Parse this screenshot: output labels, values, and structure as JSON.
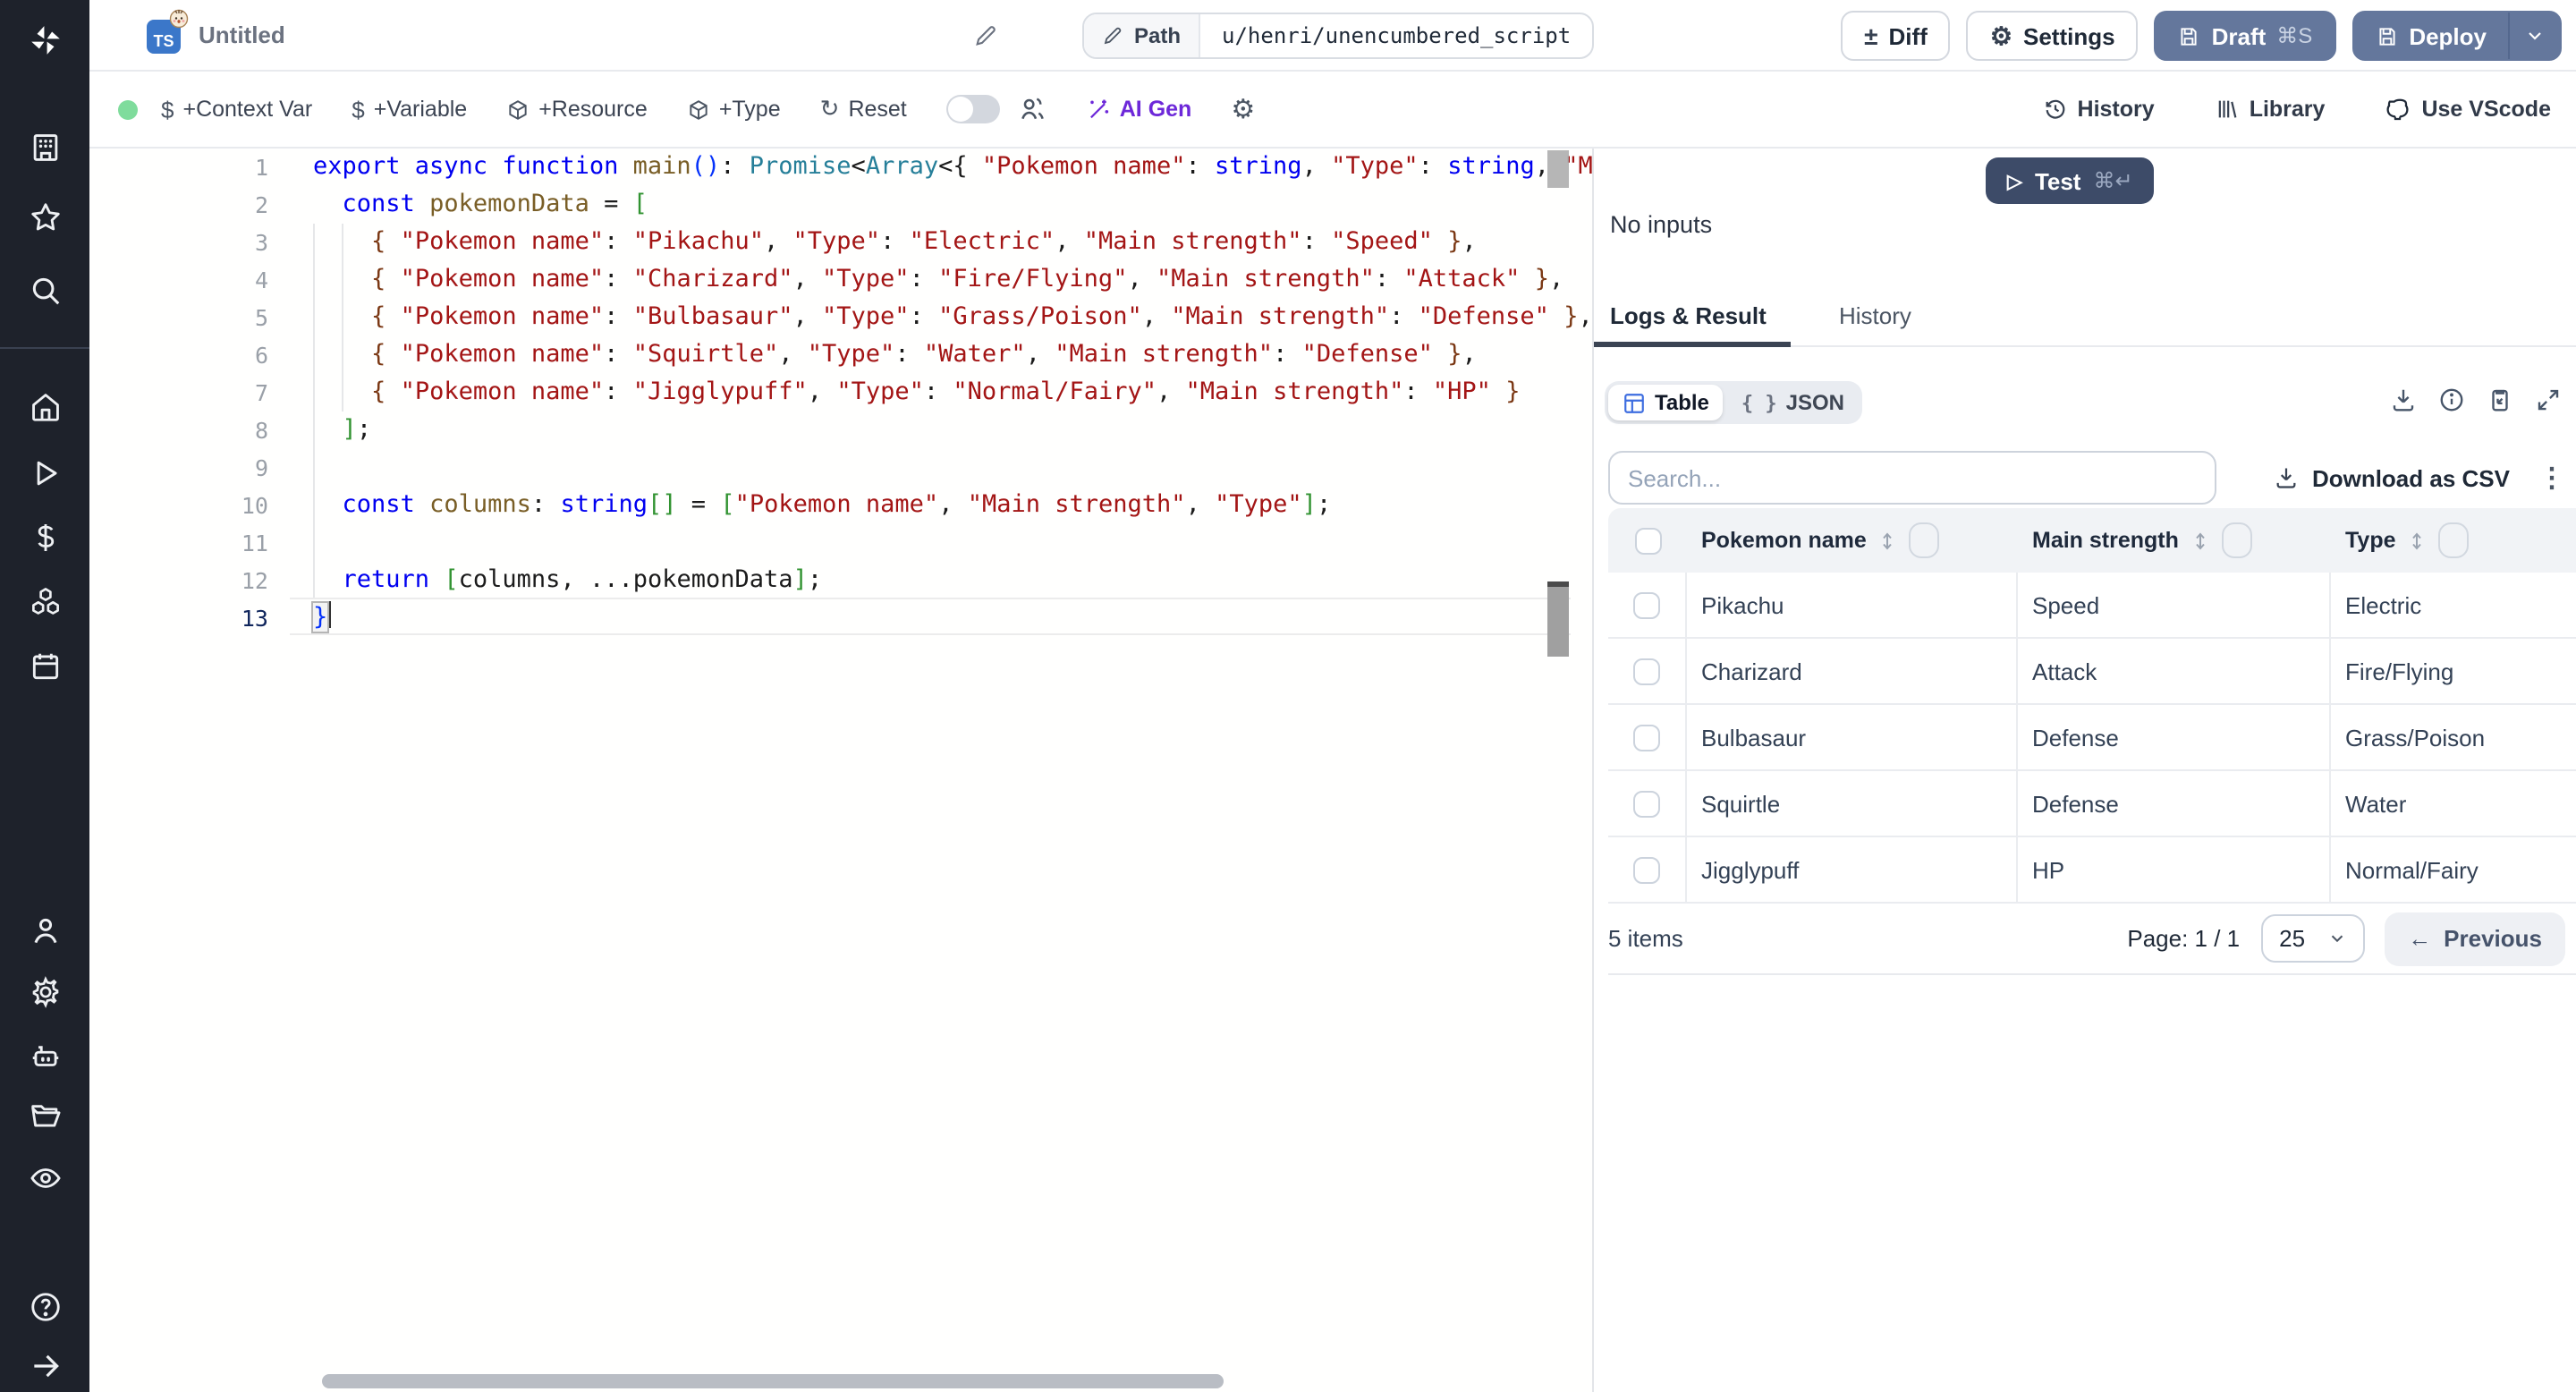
{
  "topbar": {
    "ts_label": "TS",
    "badge_emoji": "bun-face",
    "title": "Untitled",
    "path_label": "Path",
    "path_value": "u/henri/unencumbered_script",
    "diff": "Diff",
    "settings": "Settings",
    "draft": "Draft",
    "draft_kbd": "⌘S",
    "deploy": "Deploy"
  },
  "toolbar": {
    "context_var": "+Context Var",
    "variable": "+Variable",
    "resource": "+Resource",
    "type": "+Type",
    "reset": "Reset",
    "ai_gen": "AI Gen",
    "history": "History",
    "library": "Library",
    "use_vscode": "Use VScode"
  },
  "sidebar": {
    "items": [
      "windmill-logo",
      "workspace",
      "favorites",
      "search",
      "home",
      "runs",
      "variables",
      "resources",
      "schedules",
      "user",
      "settings",
      "workers",
      "folders",
      "audit-logs",
      "help",
      "expand-sidebar"
    ]
  },
  "editor": {
    "lines": [
      {
        "n": "1",
        "g": 0,
        "tokens": [
          [
            "export async function ",
            "kw"
          ],
          [
            "main",
            "fn"
          ],
          [
            "()",
            "br1"
          ],
          [
            ": ",
            "pun"
          ],
          [
            "Promise",
            "type"
          ],
          [
            "<",
            "pun"
          ],
          [
            "Array",
            "type"
          ],
          [
            "<{ ",
            "pun"
          ],
          [
            "\"Pokemon name\"",
            "str"
          ],
          [
            ": ",
            "pun"
          ],
          [
            "string",
            "kw"
          ],
          [
            ", ",
            "pun"
          ],
          [
            "\"Type\"",
            "str"
          ],
          [
            ": ",
            "pun"
          ],
          [
            "string",
            "kw"
          ],
          [
            ", ",
            "pun"
          ],
          [
            "\"Mai",
            "str"
          ]
        ]
      },
      {
        "n": "2",
        "g": 0,
        "tokens": [
          [
            "  ",
            "pun"
          ],
          [
            "const ",
            "kw"
          ],
          [
            "pokemonData",
            "fn"
          ],
          [
            " = ",
            "pun"
          ],
          [
            "[",
            "br2"
          ]
        ]
      },
      {
        "n": "3",
        "g": 2,
        "tokens": [
          [
            "    ",
            "pun"
          ],
          [
            "{ ",
            "br3"
          ],
          [
            "\"Pokemon name\"",
            "str"
          ],
          [
            ": ",
            "pun"
          ],
          [
            "\"Pikachu\"",
            "str"
          ],
          [
            ", ",
            "pun"
          ],
          [
            "\"Type\"",
            "str"
          ],
          [
            ": ",
            "pun"
          ],
          [
            "\"Electric\"",
            "str"
          ],
          [
            ", ",
            "pun"
          ],
          [
            "\"Main strength\"",
            "str"
          ],
          [
            ": ",
            "pun"
          ],
          [
            "\"Speed\"",
            "str"
          ],
          [
            " ",
            "pun"
          ],
          [
            "}",
            "br3"
          ],
          [
            ",",
            "pun"
          ]
        ]
      },
      {
        "n": "4",
        "g": 2,
        "tokens": [
          [
            "    ",
            "pun"
          ],
          [
            "{ ",
            "br3"
          ],
          [
            "\"Pokemon name\"",
            "str"
          ],
          [
            ": ",
            "pun"
          ],
          [
            "\"Charizard\"",
            "str"
          ],
          [
            ", ",
            "pun"
          ],
          [
            "\"Type\"",
            "str"
          ],
          [
            ": ",
            "pun"
          ],
          [
            "\"Fire/Flying\"",
            "str"
          ],
          [
            ", ",
            "pun"
          ],
          [
            "\"Main strength\"",
            "str"
          ],
          [
            ": ",
            "pun"
          ],
          [
            "\"Attack\"",
            "str"
          ],
          [
            " ",
            "pun"
          ],
          [
            "}",
            "br3"
          ],
          [
            ",",
            "pun"
          ]
        ]
      },
      {
        "n": "5",
        "g": 2,
        "tokens": [
          [
            "    ",
            "pun"
          ],
          [
            "{ ",
            "br3"
          ],
          [
            "\"Pokemon name\"",
            "str"
          ],
          [
            ": ",
            "pun"
          ],
          [
            "\"Bulbasaur\"",
            "str"
          ],
          [
            ", ",
            "pun"
          ],
          [
            "\"Type\"",
            "str"
          ],
          [
            ": ",
            "pun"
          ],
          [
            "\"Grass/Poison\"",
            "str"
          ],
          [
            ", ",
            "pun"
          ],
          [
            "\"Main strength\"",
            "str"
          ],
          [
            ": ",
            "pun"
          ],
          [
            "\"Defense\"",
            "str"
          ],
          [
            " ",
            "pun"
          ],
          [
            "}",
            "br3"
          ],
          [
            ",",
            "pun"
          ]
        ]
      },
      {
        "n": "6",
        "g": 2,
        "tokens": [
          [
            "    ",
            "pun"
          ],
          [
            "{ ",
            "br3"
          ],
          [
            "\"Pokemon name\"",
            "str"
          ],
          [
            ": ",
            "pun"
          ],
          [
            "\"Squirtle\"",
            "str"
          ],
          [
            ", ",
            "pun"
          ],
          [
            "\"Type\"",
            "str"
          ],
          [
            ": ",
            "pun"
          ],
          [
            "\"Water\"",
            "str"
          ],
          [
            ", ",
            "pun"
          ],
          [
            "\"Main strength\"",
            "str"
          ],
          [
            ": ",
            "pun"
          ],
          [
            "\"Defense\"",
            "str"
          ],
          [
            " ",
            "pun"
          ],
          [
            "}",
            "br3"
          ],
          [
            ",",
            "pun"
          ]
        ]
      },
      {
        "n": "7",
        "g": 2,
        "tokens": [
          [
            "    ",
            "pun"
          ],
          [
            "{ ",
            "br3"
          ],
          [
            "\"Pokemon name\"",
            "str"
          ],
          [
            ": ",
            "pun"
          ],
          [
            "\"Jigglypuff\"",
            "str"
          ],
          [
            ", ",
            "pun"
          ],
          [
            "\"Type\"",
            "str"
          ],
          [
            ": ",
            "pun"
          ],
          [
            "\"Normal/Fairy\"",
            "str"
          ],
          [
            ", ",
            "pun"
          ],
          [
            "\"Main strength\"",
            "str"
          ],
          [
            ": ",
            "pun"
          ],
          [
            "\"HP\"",
            "str"
          ],
          [
            " ",
            "pun"
          ],
          [
            "}",
            "br3"
          ]
        ]
      },
      {
        "n": "8",
        "g": 1,
        "tokens": [
          [
            "  ",
            "pun"
          ],
          [
            "]",
            "br2"
          ],
          [
            ";",
            "pun"
          ]
        ]
      },
      {
        "n": "9",
        "g": 1,
        "tokens": []
      },
      {
        "n": "10",
        "g": 1,
        "tokens": [
          [
            "  ",
            "pun"
          ],
          [
            "const ",
            "kw"
          ],
          [
            "columns",
            "fn"
          ],
          [
            ": ",
            "pun"
          ],
          [
            "string",
            "kw"
          ],
          [
            "[]",
            "br2"
          ],
          [
            " = ",
            "pun"
          ],
          [
            "[",
            "br2"
          ],
          [
            "\"Pokemon name\"",
            "str"
          ],
          [
            ", ",
            "pun"
          ],
          [
            "\"Main strength\"",
            "str"
          ],
          [
            ", ",
            "pun"
          ],
          [
            "\"Type\"",
            "str"
          ],
          [
            "]",
            "br2"
          ],
          [
            ";",
            "pun"
          ]
        ]
      },
      {
        "n": "11",
        "g": 1,
        "tokens": []
      },
      {
        "n": "12",
        "g": 1,
        "tokens": [
          [
            "  ",
            "pun"
          ],
          [
            "return ",
            "kw"
          ],
          [
            "[",
            "br2"
          ],
          [
            "columns",
            "pun"
          ],
          [
            ", ",
            "pun"
          ],
          [
            "...",
            "pun"
          ],
          [
            "pokemonData",
            "pun"
          ],
          [
            "]",
            "br2"
          ],
          [
            ";",
            "pun"
          ]
        ]
      },
      {
        "n": "13",
        "g": 0,
        "cursor": true,
        "active": true,
        "tokens": [
          [
            "}",
            "br1 brmatch"
          ]
        ]
      }
    ]
  },
  "panel": {
    "test": "Test",
    "test_kbd": "⌘↵",
    "no_inputs": "No inputs",
    "tab_logs": "Logs & Result",
    "tab_history": "History",
    "view_table": "Table",
    "view_json": "JSON",
    "search_placeholder": "Search...",
    "download_csv": "Download as CSV"
  },
  "result_table": {
    "columns": [
      "Pokemon name",
      "Main strength",
      "Type"
    ],
    "rows": [
      [
        "Pikachu",
        "Speed",
        "Electric"
      ],
      [
        "Charizard",
        "Attack",
        "Fire/Flying"
      ],
      [
        "Bulbasaur",
        "Defense",
        "Grass/Poison"
      ],
      [
        "Squirtle",
        "Defense",
        "Water"
      ],
      [
        "Jigglypuff",
        "HP",
        "Normal/Fairy"
      ]
    ],
    "items_label": "5 items",
    "page_label": "Page: 1 / 1",
    "page_size": "25",
    "prev": "Previous"
  },
  "colors": {
    "accent_slate": "#64779c",
    "test_navy": "#3d4b68",
    "sidebar_bg": "#1e222b",
    "ai_purple": "#6d28d9",
    "status_green": "#7fdc9c",
    "table_chip_blue": "#3d6de0"
  }
}
